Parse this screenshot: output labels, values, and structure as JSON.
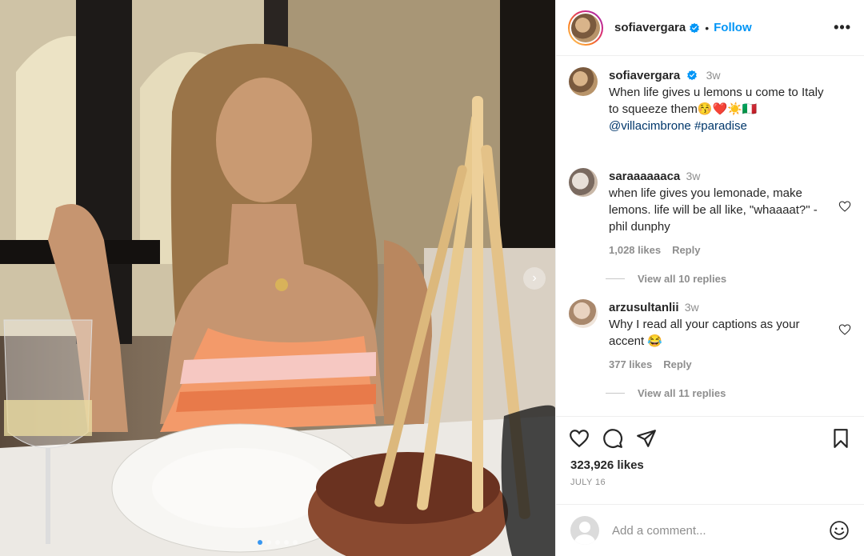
{
  "post": {
    "username": "sofiavergara",
    "follow_label": "Follow",
    "separator": "•",
    "more_label": "•••",
    "caption_time": "3w",
    "caption_line1": "When life gives u lemons u come to Italy",
    "caption_line2": "to squeeze them😚❤️☀️🇮🇹",
    "caption_mention": "@villacimbrone",
    "caption_hashtag": "#paradise",
    "likes": "323,926 likes",
    "date": "JULY 16",
    "carousel_count": 5,
    "carousel_active": 1
  },
  "comments": [
    {
      "username": "saraaaaaaca",
      "time": "3w",
      "text": "when life gives you lemonade, make lemons. life will be all like, \"whaaaat?\" -phil dunphy",
      "likes": "1,028 likes",
      "reply_label": "Reply",
      "view_replies": "View all 10 replies"
    },
    {
      "username": "arzusultanlii",
      "time": "3w",
      "text": "Why I read all your captions as your accent 😂",
      "likes": "377 likes",
      "reply_label": "Reply",
      "view_replies": "View all 11 replies"
    }
  ],
  "add_comment": {
    "placeholder": "Add a comment..."
  },
  "icons": {
    "verified": "verified-badge-icon",
    "like": "heart-icon",
    "comment": "comment-bubble-icon",
    "share": "paper-plane-icon",
    "save": "bookmark-icon",
    "emoji": "smiley-icon",
    "carousel_next": "chevron-right-icon"
  },
  "colors": {
    "link": "#00376b",
    "follow": "#0095f6",
    "verified": "#0095f6"
  }
}
